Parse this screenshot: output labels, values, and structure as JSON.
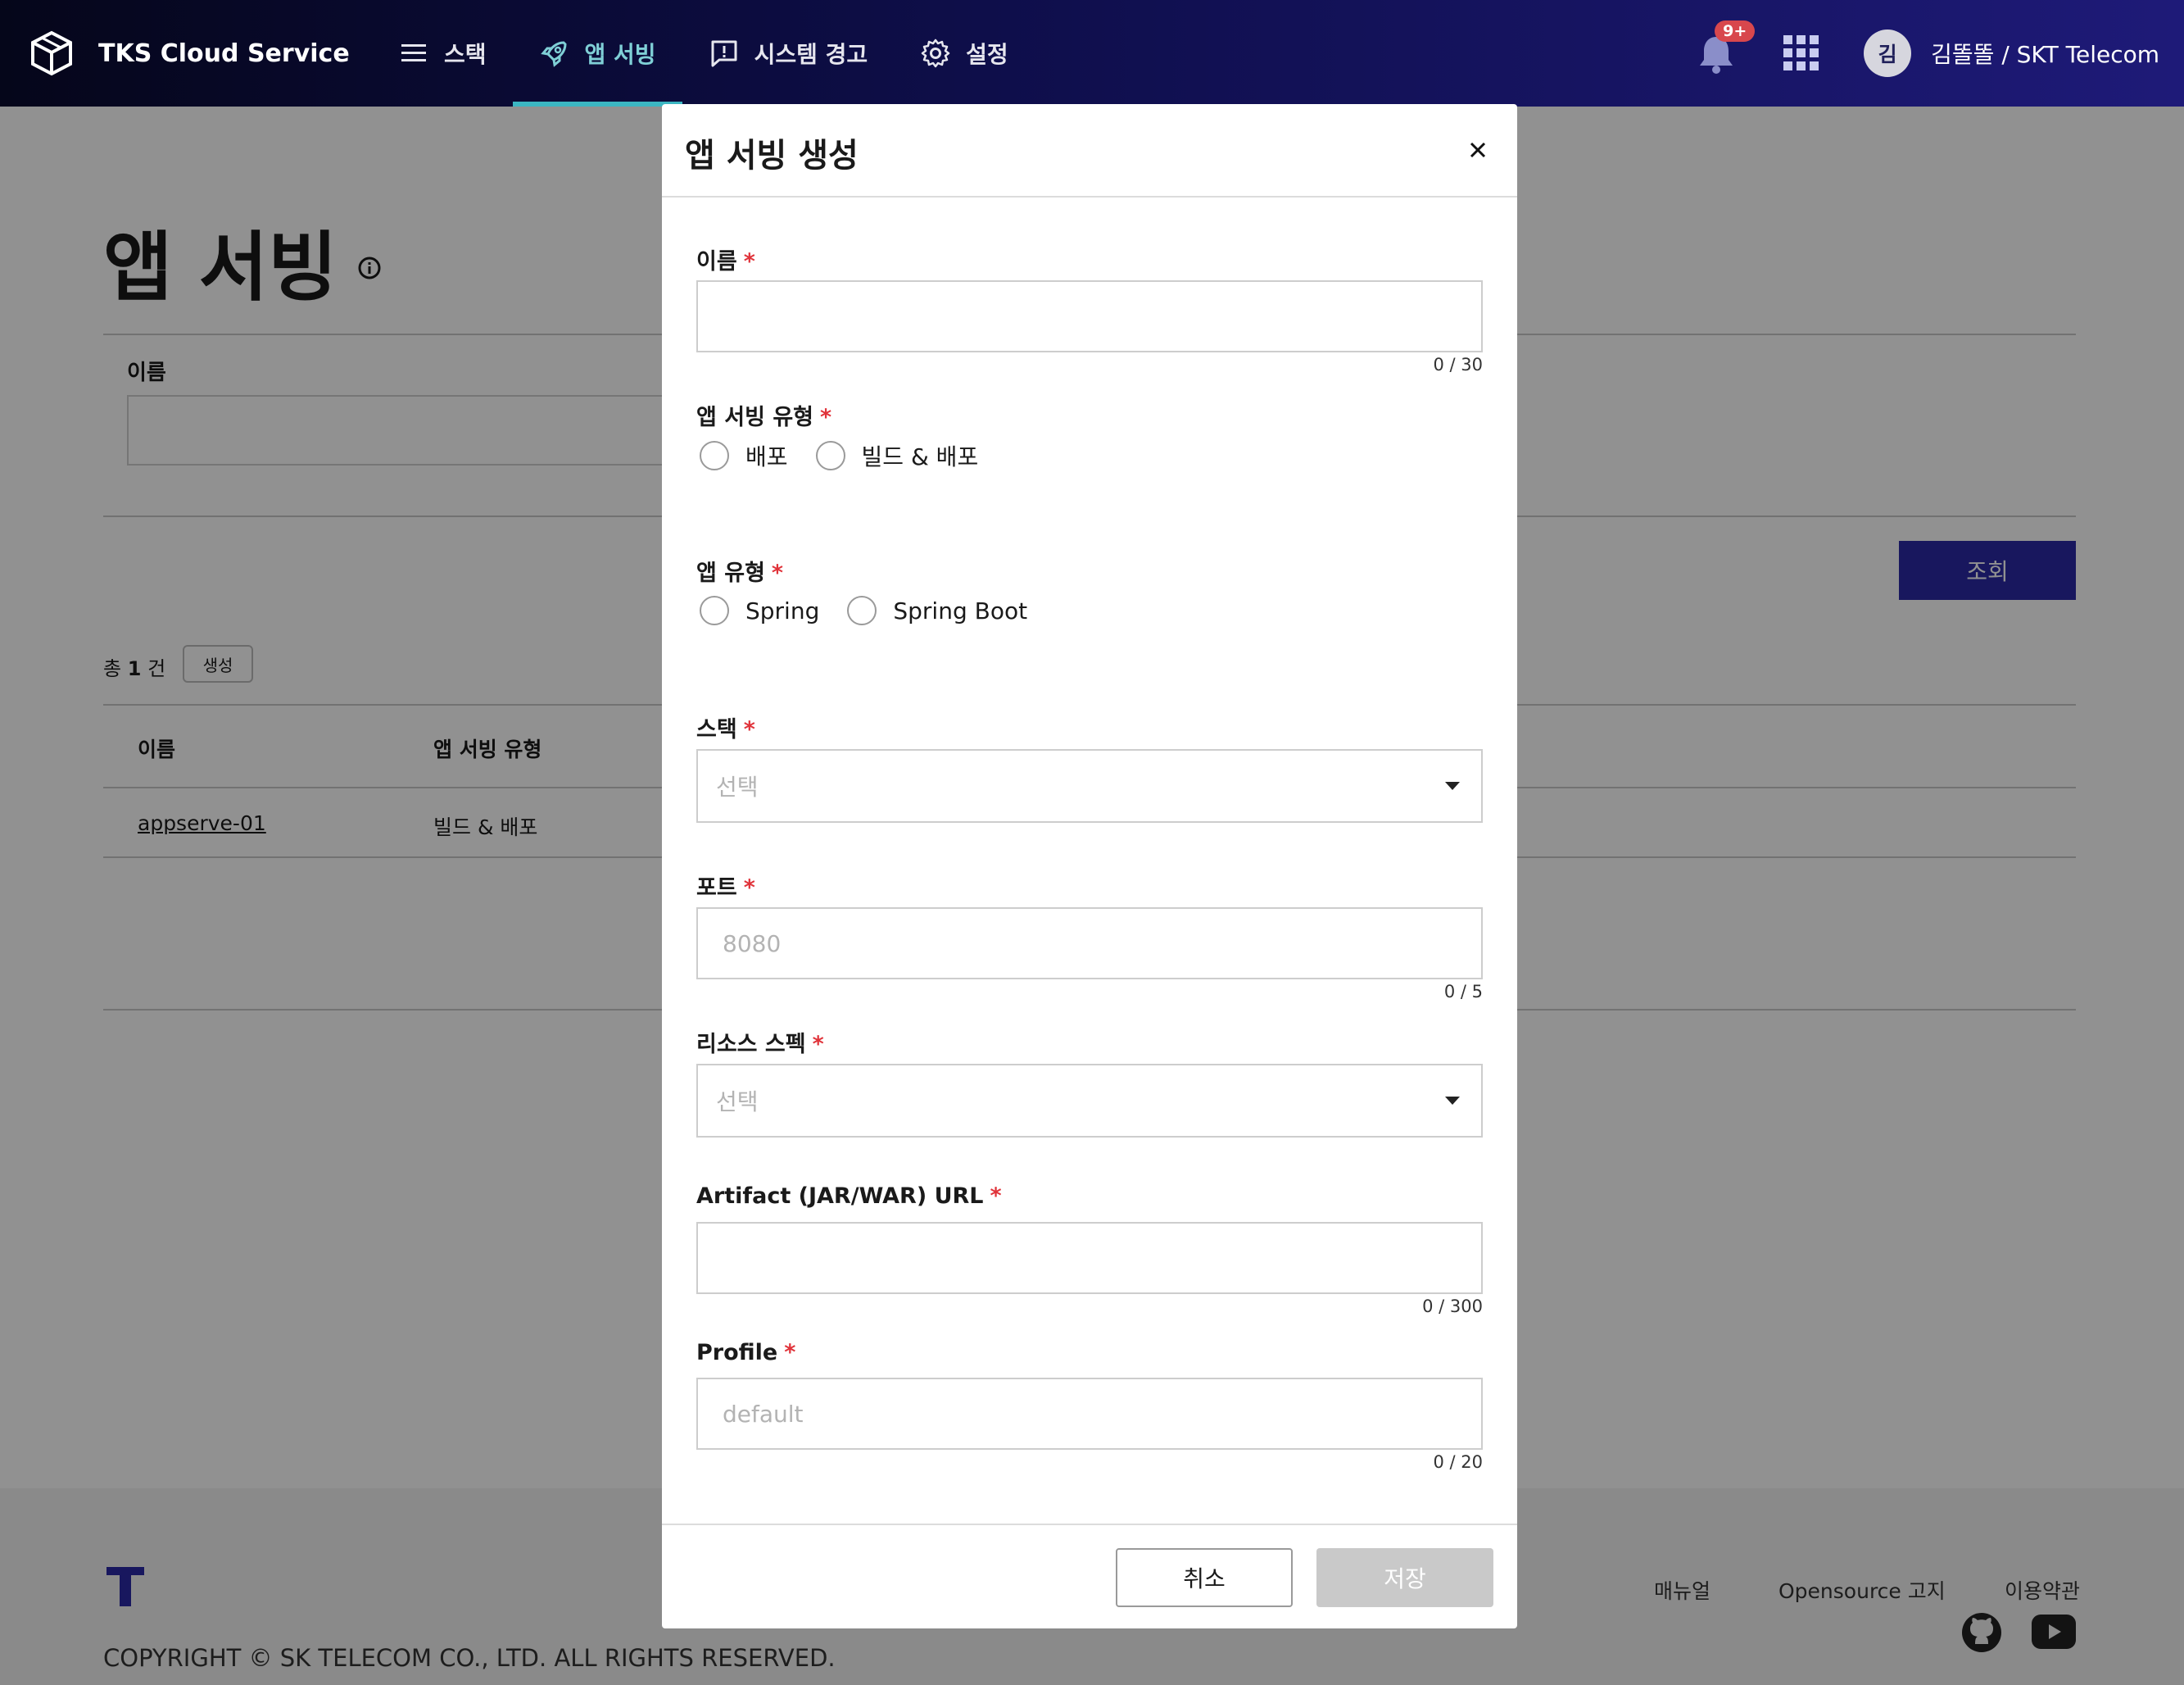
{
  "header": {
    "brand": "TKS Cloud Service",
    "nav": [
      {
        "label": "스택",
        "icon": "list-icon",
        "active": false
      },
      {
        "label": "앱 서빙",
        "icon": "rocket-icon",
        "active": true
      },
      {
        "label": "시스템 경고",
        "icon": "alert-message-icon",
        "active": false
      },
      {
        "label": "설정",
        "icon": "gear-icon",
        "active": false
      }
    ],
    "notification_badge": "9+",
    "avatar_initial": "김",
    "user": "김똘똘 / SKT Telecom"
  },
  "page": {
    "title": "앱 서빙",
    "filter_label": "이름",
    "search_button": "조회",
    "count_prefix": "총",
    "count_value": "1",
    "count_suffix": "건",
    "create_button": "생성",
    "table": {
      "headers": [
        "이름",
        "앱 서빙 유형"
      ],
      "rows": [
        {
          "name": "appserve-01",
          "type": "빌드 & 배포"
        }
      ]
    }
  },
  "footer": {
    "copyright": "COPYRIGHT © SK TELECOM CO., LTD. ALL RIGHTS RESERVED.",
    "links": [
      "매뉴얼",
      "Opensource 고지",
      "이용약관"
    ]
  },
  "modal": {
    "title": "앱 서빙 생성",
    "required_mark": "*",
    "fields": {
      "name": {
        "label": "이름",
        "value": "",
        "placeholder": "",
        "counter": "0 / 30"
      },
      "serving_type": {
        "label": "앱 서빙 유형",
        "options": [
          "배포",
          "빌드 & 배포"
        ],
        "selected": null
      },
      "app_type": {
        "label": "앱 유형",
        "options": [
          "Spring",
          "Spring Boot"
        ],
        "selected": null
      },
      "stack": {
        "label": "스택",
        "placeholder": "선택"
      },
      "port": {
        "label": "포트",
        "placeholder": "8080",
        "counter": "0 / 5"
      },
      "resource_spec": {
        "label": "리소스 스펙",
        "placeholder": "선택"
      },
      "artifact_url": {
        "label": "Artifact (JAR/WAR) URL",
        "placeholder": "",
        "counter": "0 / 300"
      },
      "profile": {
        "label": "Profile",
        "placeholder": "default",
        "counter": "0 / 20"
      }
    },
    "cancel_button": "취소",
    "save_button": "저장"
  },
  "colors": {
    "accent": "#2b2aa6",
    "nav_active": "#7fcfd6",
    "required": "#e0333a",
    "badge": "#d8474d",
    "disabled_button": "#c9c9c9"
  }
}
